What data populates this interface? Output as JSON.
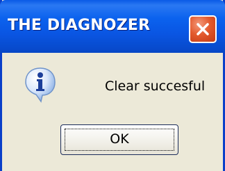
{
  "window": {
    "title": "THE DIAGNOZER"
  },
  "dialog": {
    "icon": "info-icon",
    "message": "Clear succesful",
    "ok_label": "OK"
  },
  "colors": {
    "titlebar": "#0a55e2",
    "close_button": "#e35a2e",
    "background": "#ece9d8"
  }
}
